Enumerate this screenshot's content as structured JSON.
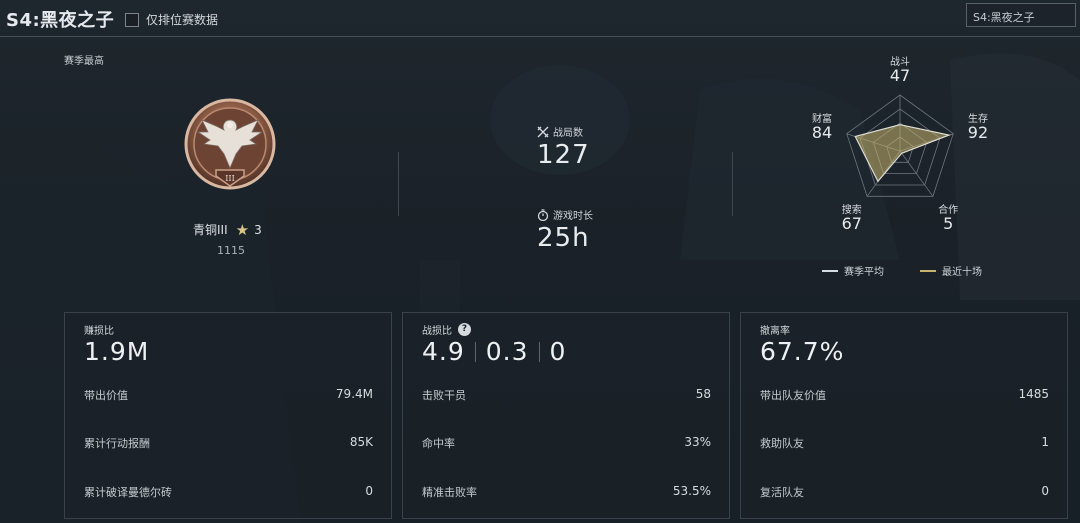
{
  "header": {
    "season_title": "S4:黑夜之子",
    "ranked_only_label": "仅排位赛数据",
    "season_select_value": "S4:黑夜之子"
  },
  "rank": {
    "section_label": "赛季最高",
    "name": "青铜III",
    "stars": "3",
    "points": "1115",
    "emblem_numeral": "III"
  },
  "summary": {
    "matches_label": "战局数",
    "matches_value": "127",
    "playtime_label": "游戏时长",
    "playtime_value": "25h"
  },
  "radar": {
    "axes": [
      {
        "label": "战斗",
        "value": "47"
      },
      {
        "label": "生存",
        "value": "92"
      },
      {
        "label": "合作",
        "value": "5"
      },
      {
        "label": "搜索",
        "value": "67"
      },
      {
        "label": "财富",
        "value": "84"
      }
    ],
    "legend_season_avg": "赛季平均",
    "legend_recent_ten": "最近十场",
    "colors": {
      "season_avg": "#d8dde1",
      "recent_ten": "#c8b46e"
    }
  },
  "cards": {
    "profit": {
      "title": "赚损比",
      "big_value": "1.9M",
      "rows": [
        {
          "label": "带出价值",
          "value": "79.4M"
        },
        {
          "label": "累计行动报酬",
          "value": "85K"
        },
        {
          "label": "累计破译曼德尔砖",
          "value": "0"
        }
      ]
    },
    "combat": {
      "title": "战损比",
      "help": "?",
      "big_values": [
        "4.9",
        "0.3",
        "0"
      ],
      "rows": [
        {
          "label": "击败干员",
          "value": "58"
        },
        {
          "label": "命中率",
          "value": "33%"
        },
        {
          "label": "精准击败率",
          "value": "53.5%"
        }
      ]
    },
    "extract": {
      "title": "撤离率",
      "big_value": "67.7%",
      "rows": [
        {
          "label": "带出队友价值",
          "value": "1485"
        },
        {
          "label": "救助队友",
          "value": "1"
        },
        {
          "label": "复活队友",
          "value": "0"
        }
      ]
    }
  }
}
